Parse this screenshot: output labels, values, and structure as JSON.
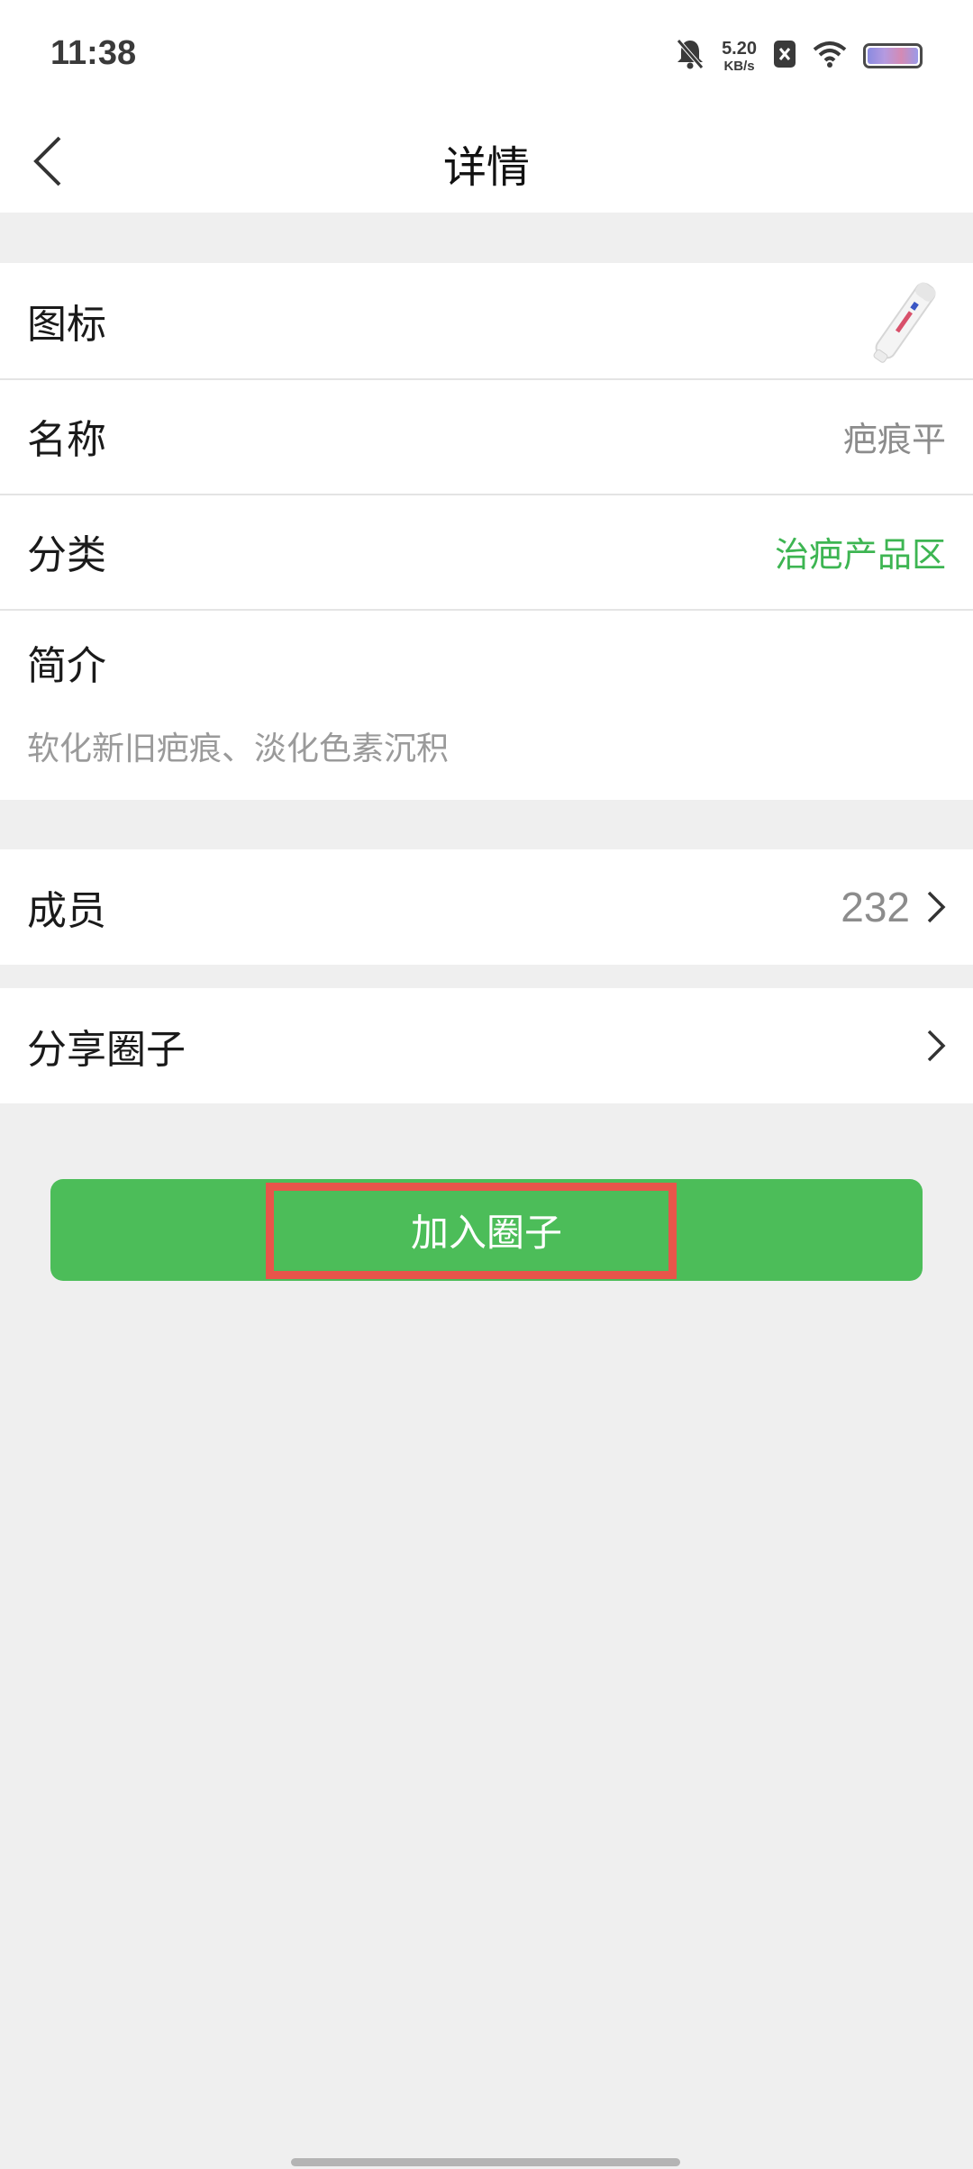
{
  "status_bar": {
    "time": "11:38",
    "net_speed_value": "5.20",
    "net_speed_unit": "KB/s"
  },
  "nav": {
    "title": "详情"
  },
  "details": {
    "icon_label": "图标",
    "name_label": "名称",
    "name_value": "疤痕平",
    "category_label": "分类",
    "category_value": "治疤产品区",
    "intro_label": "简介",
    "intro_text": "软化新旧疤痕、淡化色素沉积"
  },
  "members": {
    "label": "成员",
    "count": "232"
  },
  "share": {
    "label": "分享圈子"
  },
  "join_button": {
    "label": "加入圈子"
  },
  "colors": {
    "accent_green": "#4cbd59",
    "category_green": "#3db552",
    "highlight_red": "#e8554a",
    "background_gray": "#efefef"
  }
}
